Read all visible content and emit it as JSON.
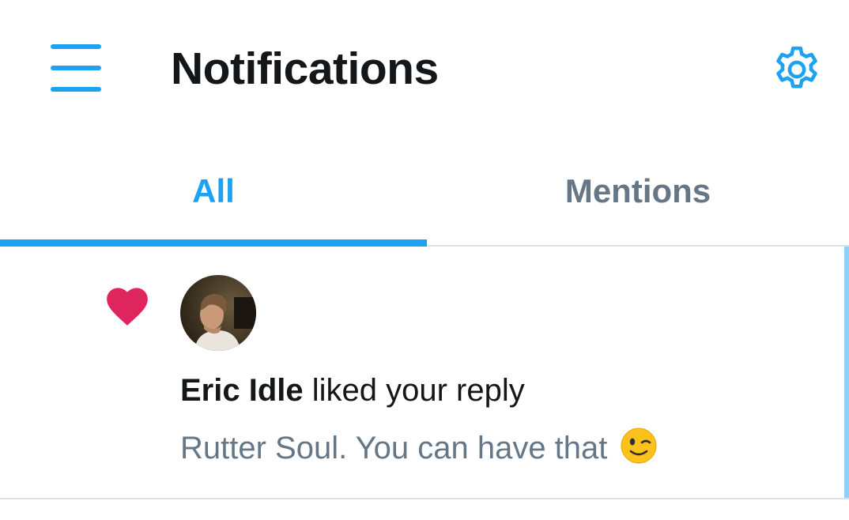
{
  "header": {
    "title": "Notifications",
    "menu_icon": "hamburger-menu-icon",
    "settings_icon": "gear-icon"
  },
  "tabs": [
    {
      "label": "All",
      "active": true
    },
    {
      "label": "Mentions",
      "active": false
    }
  ],
  "notification": {
    "type_icon": "heart-icon",
    "user_name": "Eric Idle",
    "action": "liked your reply",
    "snippet": "Rutter Soul. You can have that",
    "emoji": "winking-face-emoji"
  },
  "colors": {
    "accent": "#1da1f2",
    "heart": "#e0245e",
    "text_primary": "#14171a",
    "text_secondary": "#657786",
    "divider": "#d6e3ea"
  }
}
